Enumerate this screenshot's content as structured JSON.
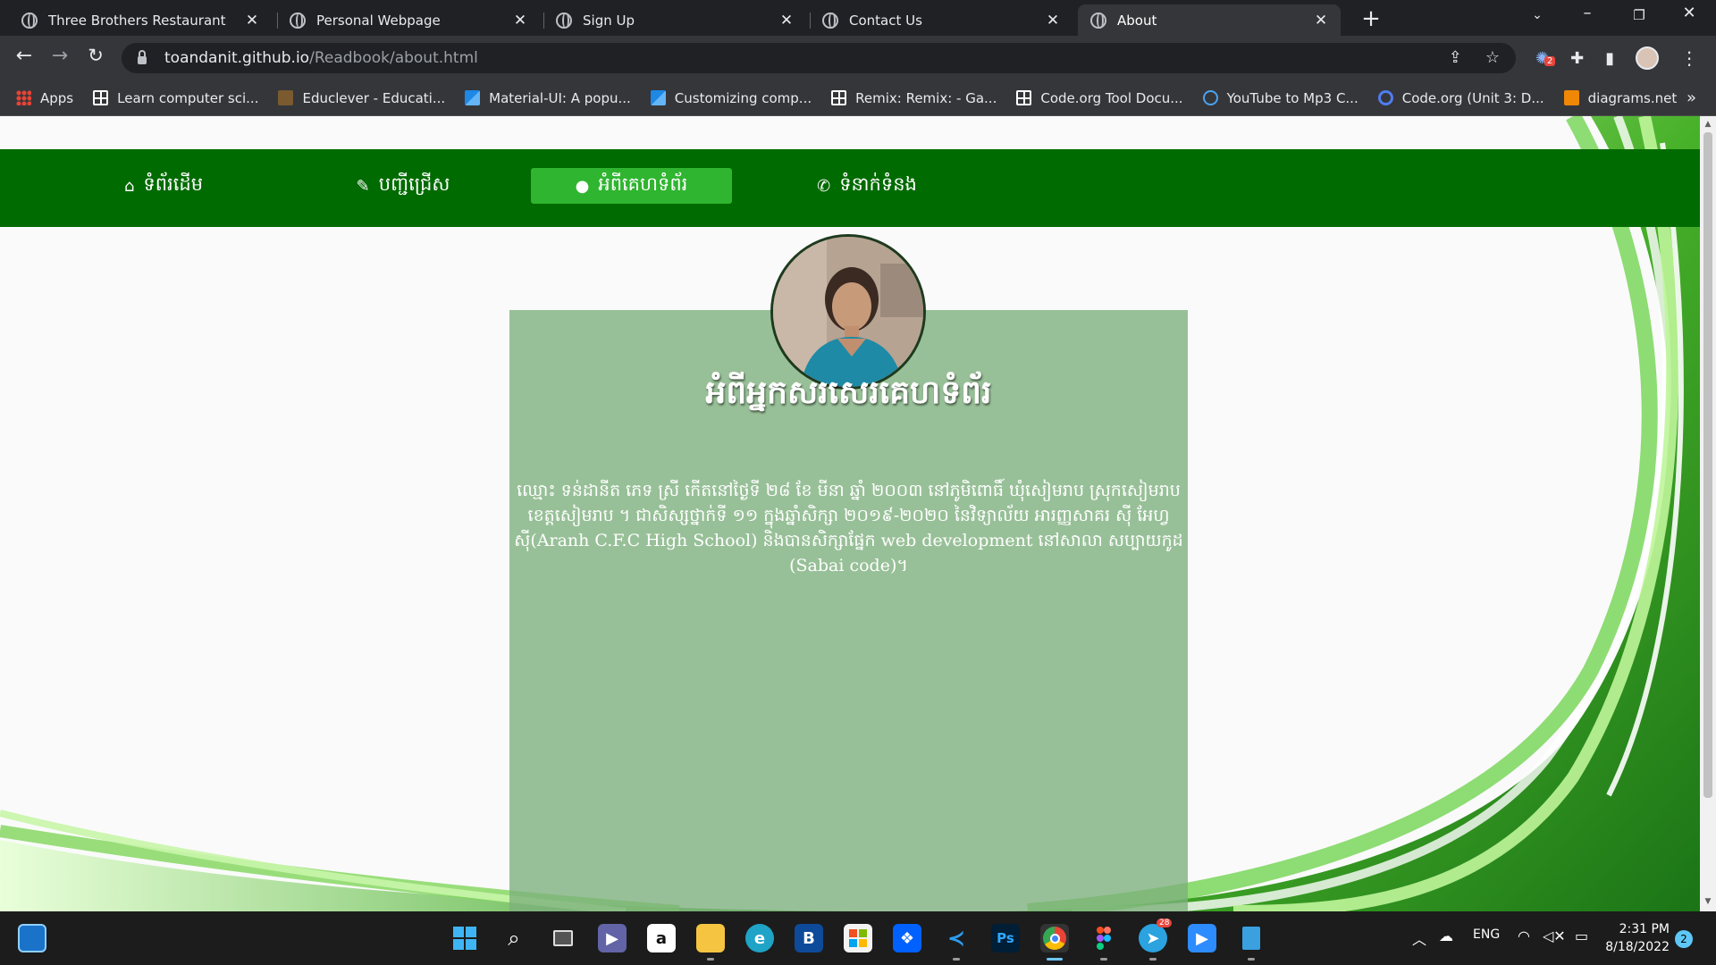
{
  "browser": {
    "tabs": [
      {
        "title": "Three Brothers Restaurant"
      },
      {
        "title": "Personal Webpage"
      },
      {
        "title": "Sign Up"
      },
      {
        "title": "Contact Us"
      },
      {
        "title": "About"
      }
    ],
    "url_host": "toandanit.github.io",
    "url_path": "/Readbook/about.html",
    "extension_badge": "2",
    "bookmarks": [
      {
        "label": "Apps",
        "icon": "apps-grid-icon",
        "color": "#ea4335"
      },
      {
        "label": "Learn computer sci...",
        "icon": "code-org-icon",
        "color": "#ffffff"
      },
      {
        "label": "Educlever - Educati...",
        "icon": "educlever-icon",
        "color": "#7a5a2e"
      },
      {
        "label": "Material-UI: A popu...",
        "icon": "material-ui-icon",
        "color": "#1e88e5"
      },
      {
        "label": "Customizing comp...",
        "icon": "material-ui-icon",
        "color": "#1e88e5"
      },
      {
        "label": "Remix: Remix: - Ga...",
        "icon": "code-org-icon",
        "color": "#ffffff"
      },
      {
        "label": "Code.org Tool Docu...",
        "icon": "code-org-icon",
        "color": "#ffffff"
      },
      {
        "label": "YouTube to Mp3 C...",
        "icon": "download-cloud-icon",
        "color": "#4aa3f0"
      },
      {
        "label": "Code.org (Unit 3: D...",
        "icon": "q-search-icon",
        "color": "#4f7cf0"
      },
      {
        "label": "diagrams.net",
        "icon": "diagrams-icon",
        "color": "#f08705"
      }
    ]
  },
  "site": {
    "nav": [
      {
        "label": "ទំព័រដើម",
        "icon": "home-icon"
      },
      {
        "label": "បញ្ជីជ្រើស",
        "icon": "edit-icon"
      },
      {
        "label": "អំពីគេហទំព័រ",
        "icon": "user-icon"
      },
      {
        "label": "ទំនាក់ទំនង",
        "icon": "phone-icon"
      }
    ],
    "active_nav": "អំពីគេហទំព័រ",
    "heading": "អំពីអ្នកសរសេរគេហទំព័រ",
    "bio": "ឈ្មោះ ទន់ដានីត ភេទ ស្រី កើតនៅថ្ងៃទី ២៨ ខែ មីនា ឆ្នាំ ២០០៣ នៅភូមិពោធិ៍ ឃុំសៀមរាប ស្រុកសៀមរាប ខេត្តសៀមរាប ។ ជាសិស្សថ្នាក់ទី ១១ ក្នុងឆ្នាំសិក្សា ២០១៩-២០២០ នៃវិទ្យាល័យ អារញ្ញសាគរ ស៊ី អែហ្វ ស៊ី(Aranh C.F.C High School) និងបានសិក្សាផ្នែក web development នៅសាលា សប្បាយកូដ (Sabai code)។",
    "colors": {
      "nav_bg": "#006b00",
      "nav_active": "#2fb52f",
      "card_bg": "#7cb07c"
    }
  },
  "taskbar": {
    "language": "ENG",
    "time": "2:31 PM",
    "date": "8/18/2022",
    "notification_count": "2",
    "telegram_badge": "28"
  }
}
